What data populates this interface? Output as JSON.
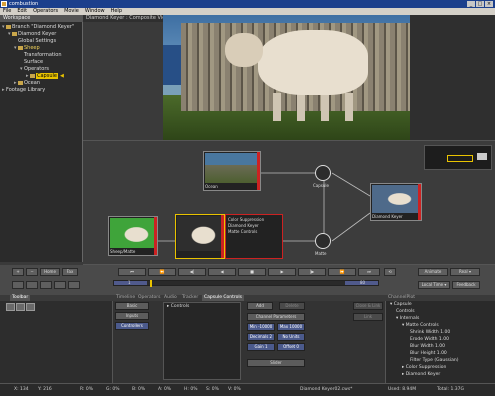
{
  "window": {
    "title": "combustion"
  },
  "menu": [
    "File",
    "Edit",
    "Operators",
    "Movie",
    "Window",
    "Help"
  ],
  "workspace": {
    "tab": "Workspace",
    "tree": [
      {
        "label": "Branch \"Diamond Keyer\"",
        "indent": 0
      },
      {
        "label": "Diamond Keyer",
        "indent": 1
      },
      {
        "label": "Global Settings",
        "indent": 1
      },
      {
        "label": "Sheep",
        "indent": 1
      },
      {
        "label": "Transformation",
        "indent": 2
      },
      {
        "label": "Surface",
        "indent": 2
      },
      {
        "label": "Operators",
        "indent": 2
      },
      {
        "label": "Capsule",
        "indent": 3,
        "selected": true
      },
      {
        "label": "Ocean",
        "indent": 1
      },
      {
        "label": "Footage Library",
        "indent": 0
      }
    ]
  },
  "viewer": {
    "label": "Diamond Keyer : Composite View (Diamond Keyer)"
  },
  "graph": {
    "nodes": {
      "ocean": "Ocean",
      "sheep": "Sheep/Matte",
      "keyer": "Diamond Keyer",
      "capsule": "Capsule",
      "matte": "Matte",
      "final": "Diamond Keyer"
    },
    "keyer_info": [
      "Color Suppression",
      "Diamond Keyer",
      "Matte Controls"
    ]
  },
  "transport": {
    "left_buttons": [
      "+",
      "−",
      "Home",
      "Fax"
    ],
    "frame": "1",
    "end_frame": "80",
    "buttons": [
      "Animate",
      "Real",
      "Local Time",
      "Feedback"
    ],
    "dropdowns": [
      "Real ▾",
      "Local Time ▾"
    ]
  },
  "tabs": [
    "Toolbar",
    "Timeline",
    "Operators",
    "Audio",
    "Tracker",
    "Capsule Controls",
    "ChannelPlot"
  ],
  "toolbar": {
    "label": "Toolbar"
  },
  "controls": {
    "left": [
      "Basic",
      "Inputs",
      "Controllers"
    ],
    "controls_label": "Controls",
    "add": "Add",
    "delete": "Delete",
    "channel_params": "Channel Parameters",
    "min": "Min -10000",
    "max": "Max 10000",
    "decimals": "Decimals 2",
    "no_units": "No Units",
    "gain": "Gain 1",
    "offset": "Offset 0",
    "slider": "Slider",
    "close_link": "Close & Link",
    "link": "Link"
  },
  "channels": {
    "header": "ChannelPlot",
    "items": [
      {
        "label": "Capsule",
        "indent": 0
      },
      {
        "label": "Controls",
        "indent": 1
      },
      {
        "label": "Internals",
        "indent": 1
      },
      {
        "label": "Matte Controls",
        "indent": 2
      },
      {
        "label": "Shrink Width  1.00",
        "indent": 3
      },
      {
        "label": "Erode Width  1.00",
        "indent": 3
      },
      {
        "label": "Blur Width  1.00",
        "indent": 3
      },
      {
        "label": "Blur Height  1.00",
        "indent": 3
      },
      {
        "label": "Filter Type  (Gaussian)",
        "indent": 3
      },
      {
        "label": "Color Suppression",
        "indent": 2
      },
      {
        "label": "Diamond Keyer",
        "indent": 2
      }
    ]
  },
  "status": {
    "x": "X: 134",
    "y": "Y: 216",
    "r": "R: 0%",
    "g": "G: 0%",
    "b": "B: 0%",
    "a": "A: 0%",
    "h": "H: 0%",
    "s": "S: 0%",
    "v": "V: 0%",
    "file": "Diamond Keyer02.cws*",
    "used": "Used: 8.94M",
    "total": "Total: 1.37G"
  },
  "colors": {
    "accent": "#e9c300",
    "node_bar": "#cc2222",
    "title": "#1b3f8c"
  }
}
